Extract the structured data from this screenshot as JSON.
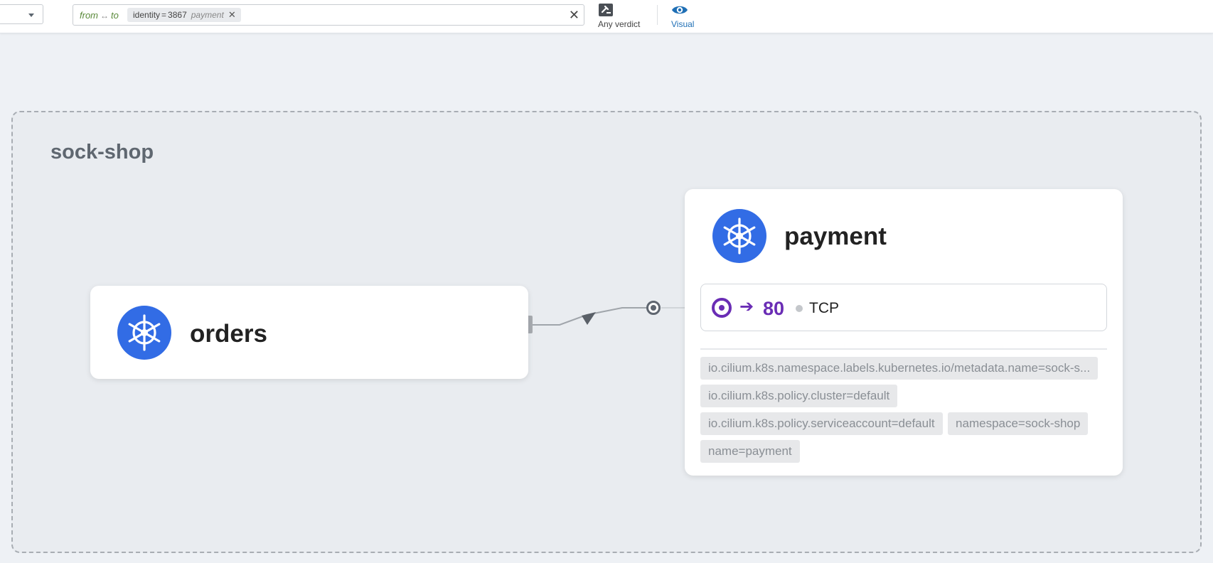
{
  "toolbar": {
    "namespace_select": {
      "value": ""
    },
    "filter": {
      "from_label": "from",
      "direction_arrow": "↔",
      "to_label": "to",
      "tag": {
        "key": "identity",
        "op": "=",
        "value": "3867",
        "sub": "payment"
      }
    },
    "verdict_label": "Any verdict",
    "visual_label": "Visual"
  },
  "namespace": {
    "title": "sock-shop"
  },
  "services": {
    "orders": {
      "name": "orders",
      "icon": "kubernetes-icon"
    },
    "payment": {
      "name": "payment",
      "icon": "kubernetes-icon",
      "port": {
        "arrow": "➔",
        "number": "80",
        "protocol": "TCP"
      },
      "labels": [
        "io.cilium.k8s.namespace.labels.kubernetes.io/metadata.name=sock-s...",
        "io.cilium.k8s.policy.cluster=default",
        "io.cilium.k8s.policy.serviceaccount=default",
        "namespace=sock-shop",
        "name=payment"
      ]
    }
  },
  "colors": {
    "kubernetes_blue": "#326ce5",
    "port_purple": "#6a2db5",
    "visual_accent": "#1f6fb5",
    "filter_direction": "#5a8a3a"
  }
}
